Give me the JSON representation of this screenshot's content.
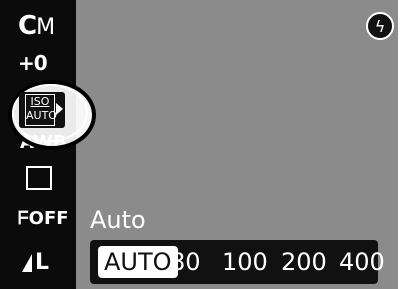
{
  "menu": {
    "mode_c": "C",
    "mode_m": "M",
    "exposure": "+0",
    "iso_top": "ISO",
    "iso_bottom": "AUTO",
    "white_balance": "AWB",
    "my_colors": "OFF",
    "quality": "L"
  },
  "flash_icon": "flash-off-icon",
  "setting": {
    "title": "Auto",
    "options": [
      "AUTO",
      "80",
      "100",
      "200",
      "400"
    ],
    "selected": "AUTO"
  }
}
